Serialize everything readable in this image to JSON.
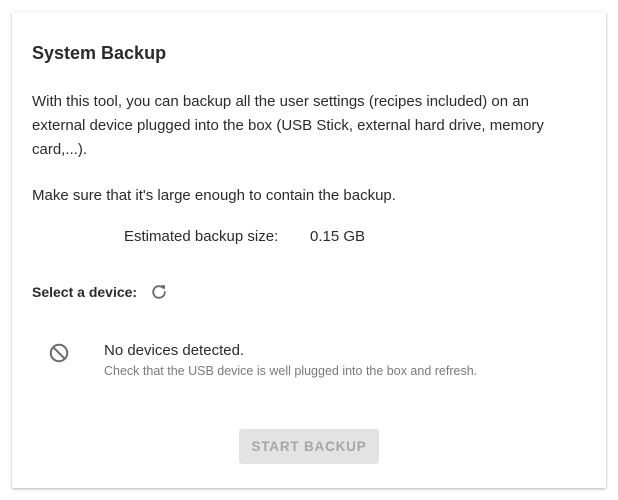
{
  "backup": {
    "title": "System Backup",
    "description": "With this tool, you can backup all the user settings (recipes included) on an external device plugged into the box (USB Stick, external hard drive, memory card,...).",
    "note": "Make sure that it's large enough to contain the backup.",
    "estimated_label": "Estimated backup size:",
    "estimated_value": "0.15 GB",
    "select_label": "Select a device:",
    "no_devices_title": "No devices detected.",
    "no_devices_hint": "Check that the USB device is well plugged into the box and refresh.",
    "start_button_label": "START BACKUP",
    "start_button_state": "disabled"
  },
  "icons": {
    "refresh": "refresh-icon",
    "no_device": "block-icon"
  },
  "colors": {
    "text": "#2b2b2b",
    "hint": "#7a7a7a",
    "disabled_bg": "#e3e3e3",
    "disabled_text": "#a6a6a6",
    "icon": "#6b6b6b"
  }
}
